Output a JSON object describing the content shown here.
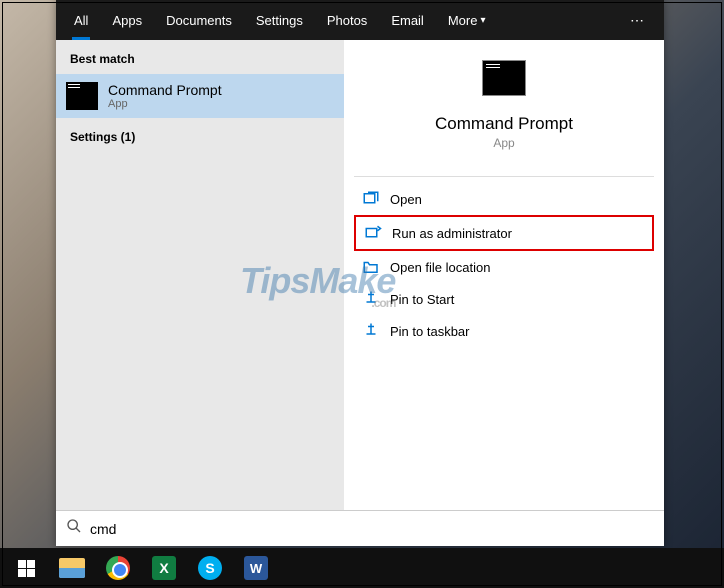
{
  "tabs": {
    "all": "All",
    "apps": "Apps",
    "documents": "Documents",
    "settings": "Settings",
    "photos": "Photos",
    "email": "Email",
    "more": "More"
  },
  "left": {
    "best_match": "Best match",
    "result_title": "Command Prompt",
    "result_sub": "App",
    "settings_hdr": "Settings (1)"
  },
  "preview": {
    "title": "Command Prompt",
    "sub": "App"
  },
  "actions": {
    "open": "Open",
    "run_admin": "Run as administrator",
    "open_loc": "Open file location",
    "pin_start": "Pin to Start",
    "pin_taskbar": "Pin to taskbar"
  },
  "search": {
    "value": "cmd"
  },
  "watermark": "TipsMake",
  "watermark_sub": ".com"
}
